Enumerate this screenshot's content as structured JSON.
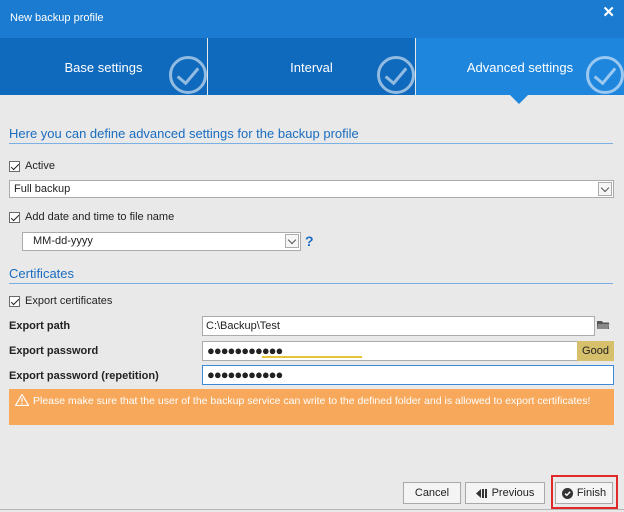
{
  "window": {
    "title": "New backup profile",
    "close_icon": "close-icon"
  },
  "tabs": [
    {
      "label": "Base settings",
      "completed": true,
      "active": false
    },
    {
      "label": "Interval",
      "completed": true,
      "active": false
    },
    {
      "label": "Advanced settings",
      "completed": true,
      "active": true
    }
  ],
  "section_heading": "Here you can define advanced settings for the backup profile",
  "active_checkbox": {
    "label": "Active",
    "checked": true
  },
  "backup_type": {
    "value": "Full backup"
  },
  "date_time_checkbox": {
    "label": "Add date and time to file name",
    "checked": true
  },
  "date_format": {
    "value": "MM-dd-yyyy",
    "help": "?"
  },
  "certificates": {
    "heading": "Certificates",
    "export_checkbox": {
      "label": "Export certificates",
      "checked": true
    },
    "export_path": {
      "label": "Export path",
      "value": "C:\\Backup\\Test"
    },
    "export_password": {
      "label": "Export password",
      "masked": "●●●●●●●●●●●",
      "strength": "Good"
    },
    "export_password_repeat": {
      "label": "Export password (repetition)",
      "masked": "●●●●●●●●●●●"
    }
  },
  "warning": {
    "text": "Please make sure that the user of the backup service can write to the defined folder and is allowed to export certificates!"
  },
  "buttons": {
    "cancel": "Cancel",
    "previous": "Previous",
    "finish": "Finish"
  },
  "colors": {
    "titlebar": "#1a7bd0",
    "tab": "#0f69bd",
    "tab_active": "#1f86de",
    "accent_text": "#1a6dc0",
    "warning": "#f7a85b",
    "strength_good": "#d6c06c",
    "highlight": "#e02a2a"
  }
}
